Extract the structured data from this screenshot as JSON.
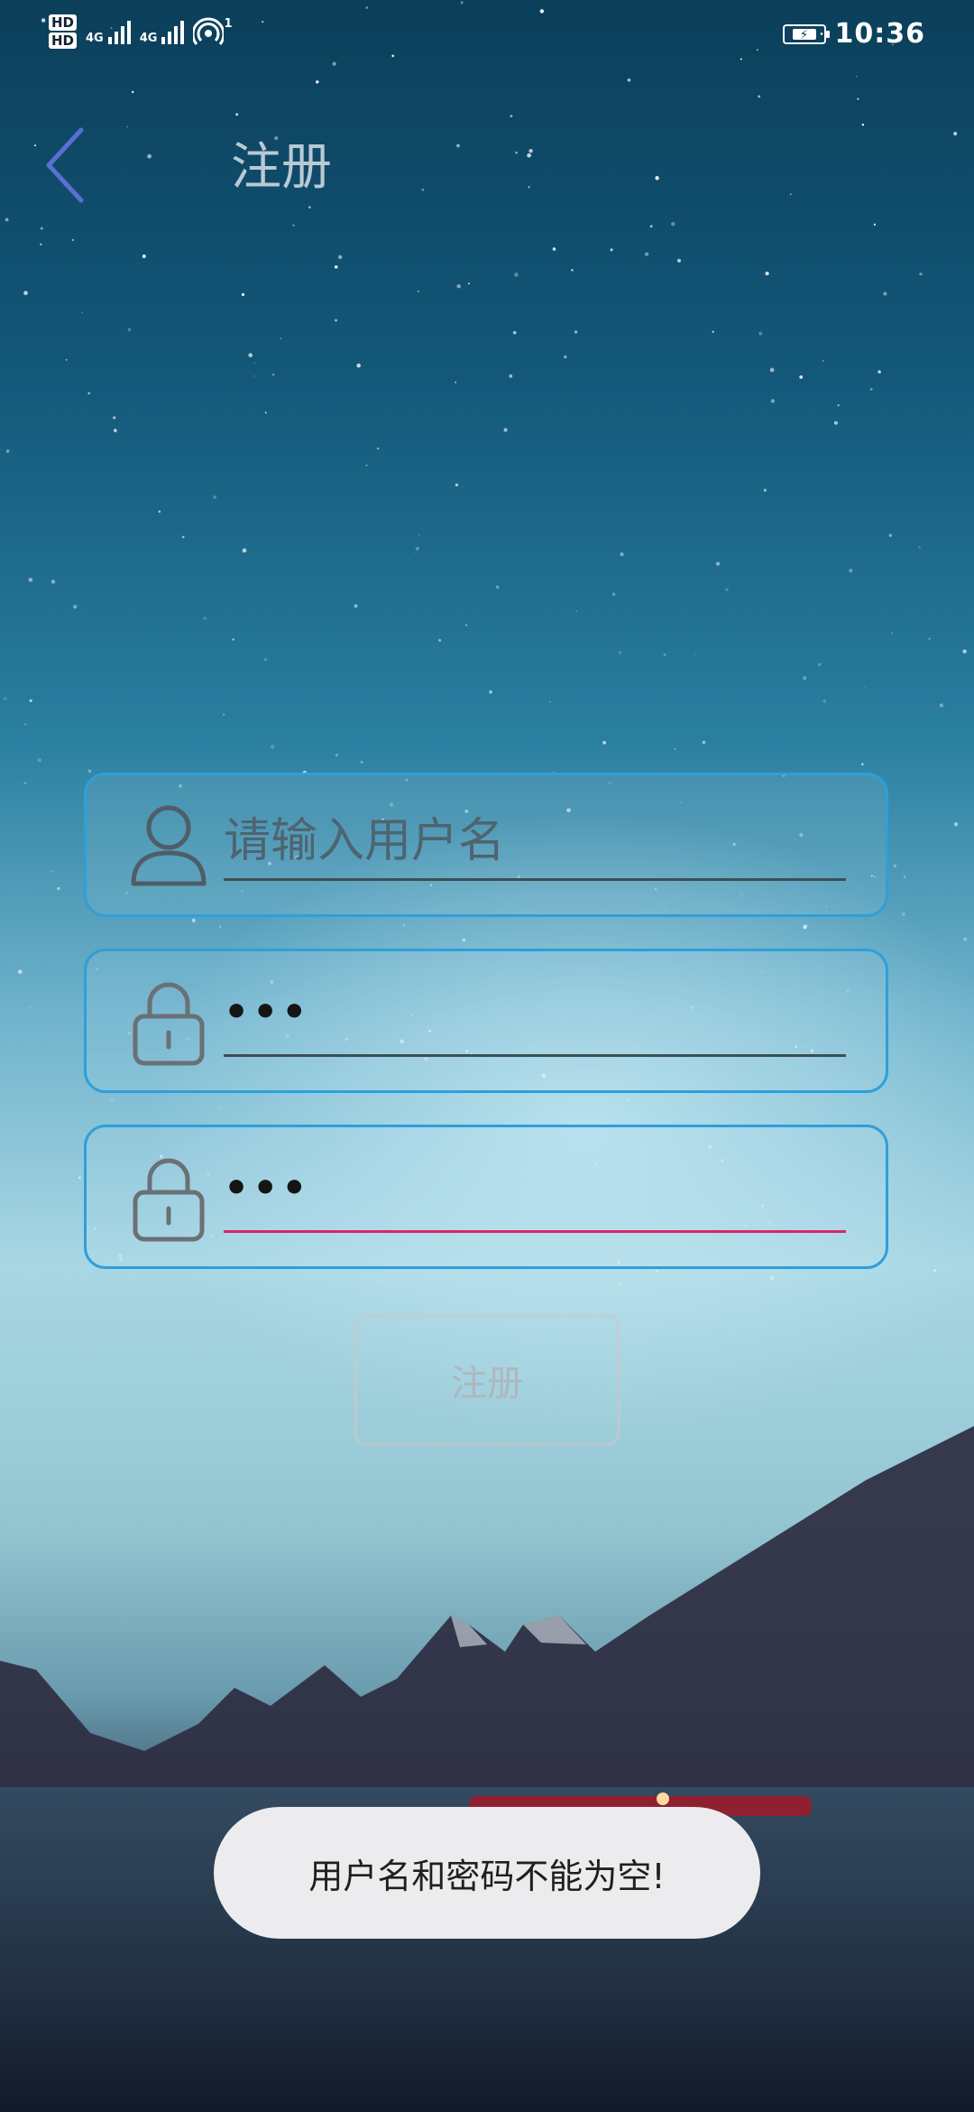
{
  "status_bar": {
    "hd1": "HD",
    "hd2": "HD",
    "sim1_label": "4G",
    "sim2_label": "4G",
    "hotspot_badge": "1",
    "time": "10:36",
    "battery_icon": "battery-charging-icon",
    "wifi_icon": "hotspot-icon"
  },
  "header": {
    "back_icon": "chevron-left-icon",
    "title": "注册"
  },
  "form": {
    "username": {
      "placeholder": "请输入用户名",
      "value": "",
      "icon": "user-icon"
    },
    "password": {
      "value": "•••",
      "icon": "lock-icon"
    },
    "confirm_password": {
      "value": "•••",
      "icon": "lock-icon"
    },
    "submit_label": "注册"
  },
  "toast": {
    "message": "用户名和密码不能为空!"
  },
  "colors": {
    "field_border": "#2f9fda",
    "active_underline": "#d8266a",
    "back_icon": "#5a6fd0"
  }
}
